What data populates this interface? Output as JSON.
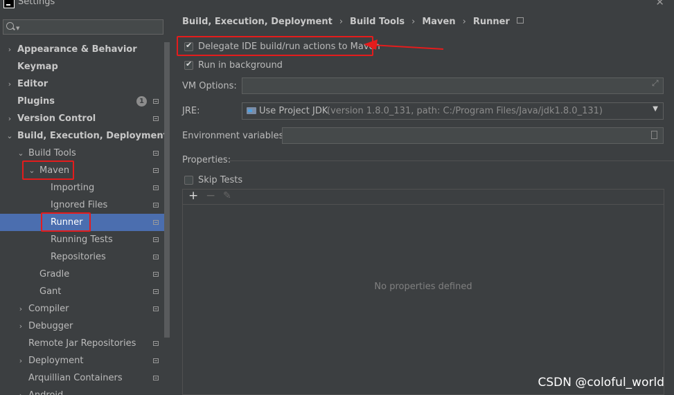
{
  "window": {
    "title": "Settings",
    "close_glyph": "✕"
  },
  "search": {
    "placeholder": ""
  },
  "sidebar": {
    "items": [
      {
        "label": "Appearance & Behavior",
        "arrow": "›",
        "bold": true
      },
      {
        "label": "Keymap",
        "bold": true
      },
      {
        "label": "Editor",
        "arrow": "›",
        "bold": true
      },
      {
        "label": "Plugins",
        "bold": true,
        "badge": "1"
      },
      {
        "label": "Version Control",
        "arrow": "›",
        "bold": true
      },
      {
        "label": "Build, Execution, Deployment",
        "arrow": "⌄",
        "bold": true
      },
      {
        "label": "Build Tools",
        "arrow": "⌄"
      },
      {
        "label": "Maven",
        "arrow": "⌄"
      },
      {
        "label": "Importing"
      },
      {
        "label": "Ignored Files"
      },
      {
        "label": "Runner",
        "selected": true
      },
      {
        "label": "Running Tests"
      },
      {
        "label": "Repositories"
      },
      {
        "label": "Gradle"
      },
      {
        "label": "Gant"
      },
      {
        "label": "Compiler",
        "arrow": "›"
      },
      {
        "label": "Debugger",
        "arrow": "›"
      },
      {
        "label": "Remote Jar Repositories"
      },
      {
        "label": "Deployment",
        "arrow": "›"
      },
      {
        "label": "Arquillian Containers"
      },
      {
        "label": "Android",
        "arrow": "›"
      }
    ]
  },
  "breadcrumb": [
    "Build, Execution, Deployment",
    "Build Tools",
    "Maven",
    "Runner"
  ],
  "runner": {
    "delegate_label": "Delegate IDE build/run actions to Maven",
    "delegate_checked": true,
    "background_label": "Run in background",
    "background_checked": true,
    "vm_options_label": "VM Options:",
    "vm_options_value": "",
    "jre_label": "JRE:",
    "jre_value": "Use Project JDK",
    "jre_detail": "(version 1.8.0_131, path: C:/Program Files/Java/jdk1.8.0_131)",
    "env_label": "Environment variables:",
    "env_value": "",
    "properties_label": "Properties:",
    "skip_tests_label": "Skip Tests",
    "skip_tests_checked": false,
    "add_glyph": "+",
    "remove_glyph": "−",
    "edit_glyph": "✎",
    "empty_text": "No properties defined"
  },
  "watermark": "CSDN @coloful_world",
  "colors": {
    "highlight": "#e51c1c",
    "selection": "#4b6eaf",
    "background": "#3c3f41"
  }
}
